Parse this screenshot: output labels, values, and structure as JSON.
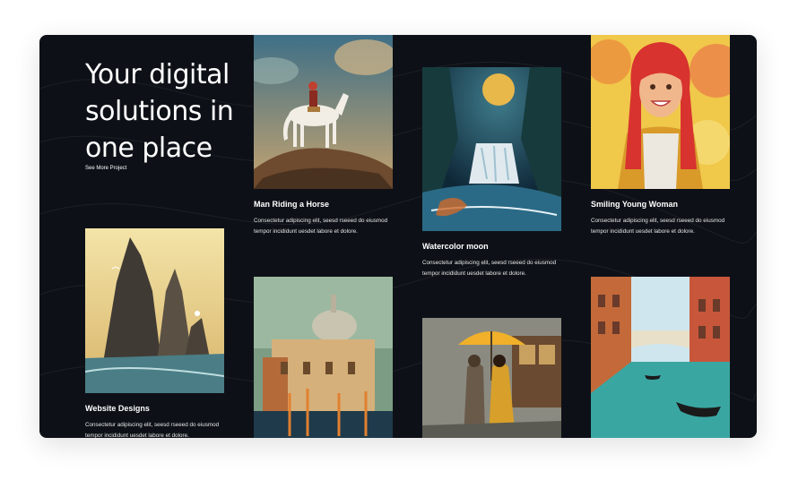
{
  "hero": {
    "title": "Your digital solutions in one place",
    "link": "See More Project"
  },
  "projects": [
    {
      "title": "Man Riding a Horse",
      "desc": "Consectetur adipiscing elit, seesd rseeed do eiusmod tempor incididunt uesdet labore et dolore."
    },
    {
      "title": "Watercolor moon",
      "desc": "Consectetur adipiscing elit, seesd rseeed do eiusmod tempor incididunt uesdet labore et dolore."
    },
    {
      "title": "Smiling Young Woman",
      "desc": "Consectetur adipiscing elit, seesd rseeed do eiusmod tempor incididunt uesdet labore et dolore."
    },
    {
      "title": "Website Designs",
      "desc": "Consectetur adipiscing elit, seesd rseeed do eiusmod tempor incididunt uesdet labore et dolore."
    }
  ],
  "colors": {
    "background": "#0d1117",
    "text": "#ffffff"
  }
}
